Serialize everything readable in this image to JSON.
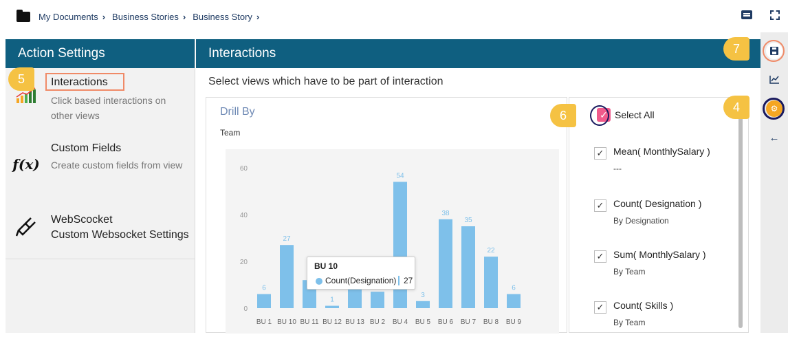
{
  "breadcrumb": [
    "My Documents",
    "Business Stories",
    "Business Story"
  ],
  "left_panel": {
    "title": "Action Settings",
    "items": [
      {
        "title": "Interactions",
        "desc": "Click based interactions on other views"
      },
      {
        "title": "Custom Fields",
        "desc": "Create custom fields from view"
      },
      {
        "title": "WebScocket",
        "desc": "Custom Websocket Settings"
      }
    ]
  },
  "main": {
    "title": "Interactions",
    "subtitle": "Select views which have to be part of interaction"
  },
  "callouts": [
    "5",
    "6",
    "7",
    "4"
  ],
  "chart_card": {
    "title": "Drill By",
    "subtitle": "Team"
  },
  "chart_data": {
    "type": "bar",
    "categories": [
      "BU 1",
      "BU 10",
      "BU 11",
      "BU 12",
      "BU 13",
      "BU 2",
      "BU 4",
      "BU 5",
      "BU 6",
      "BU 7",
      "BU 8",
      "BU 9"
    ],
    "values": [
      6,
      27,
      12,
      1,
      10,
      7,
      54,
      3,
      38,
      35,
      22,
      6
    ],
    "data_labels": [
      "6",
      "27",
      "",
      "1",
      "",
      "",
      "54",
      "3",
      "38",
      "35",
      "22",
      "6"
    ],
    "yticks": [
      "0",
      "20",
      "40",
      "60"
    ],
    "ylim": [
      0,
      60
    ],
    "color": "#7ec0ea",
    "grid": false
  },
  "tooltip": {
    "title": "BU 10",
    "label": "Count(Designation)",
    "value": "27"
  },
  "select_all": {
    "label": "Select All"
  },
  "options": [
    {
      "title": "Mean( MonthlySalary )",
      "sub": "---"
    },
    {
      "title": "Count( Designation )",
      "sub": "By Designation"
    },
    {
      "title": "Sum( MonthlySalary )",
      "sub": "By Team"
    },
    {
      "title": "Count( Skills )",
      "sub": "By Team"
    }
  ],
  "colors": {
    "header": "#0f5f80",
    "accent": "#f5c243",
    "pink": "#f05a8b",
    "navy": "#1f3b63"
  },
  "icons": [
    "folder-icon",
    "chevron-right-icon",
    "comment-icon",
    "fullscreen-icon",
    "save-icon",
    "chart-icon",
    "settings-icon",
    "back-arrow-icon",
    "bar-chart-icon",
    "function-icon",
    "websocket-icon",
    "check-icon"
  ]
}
